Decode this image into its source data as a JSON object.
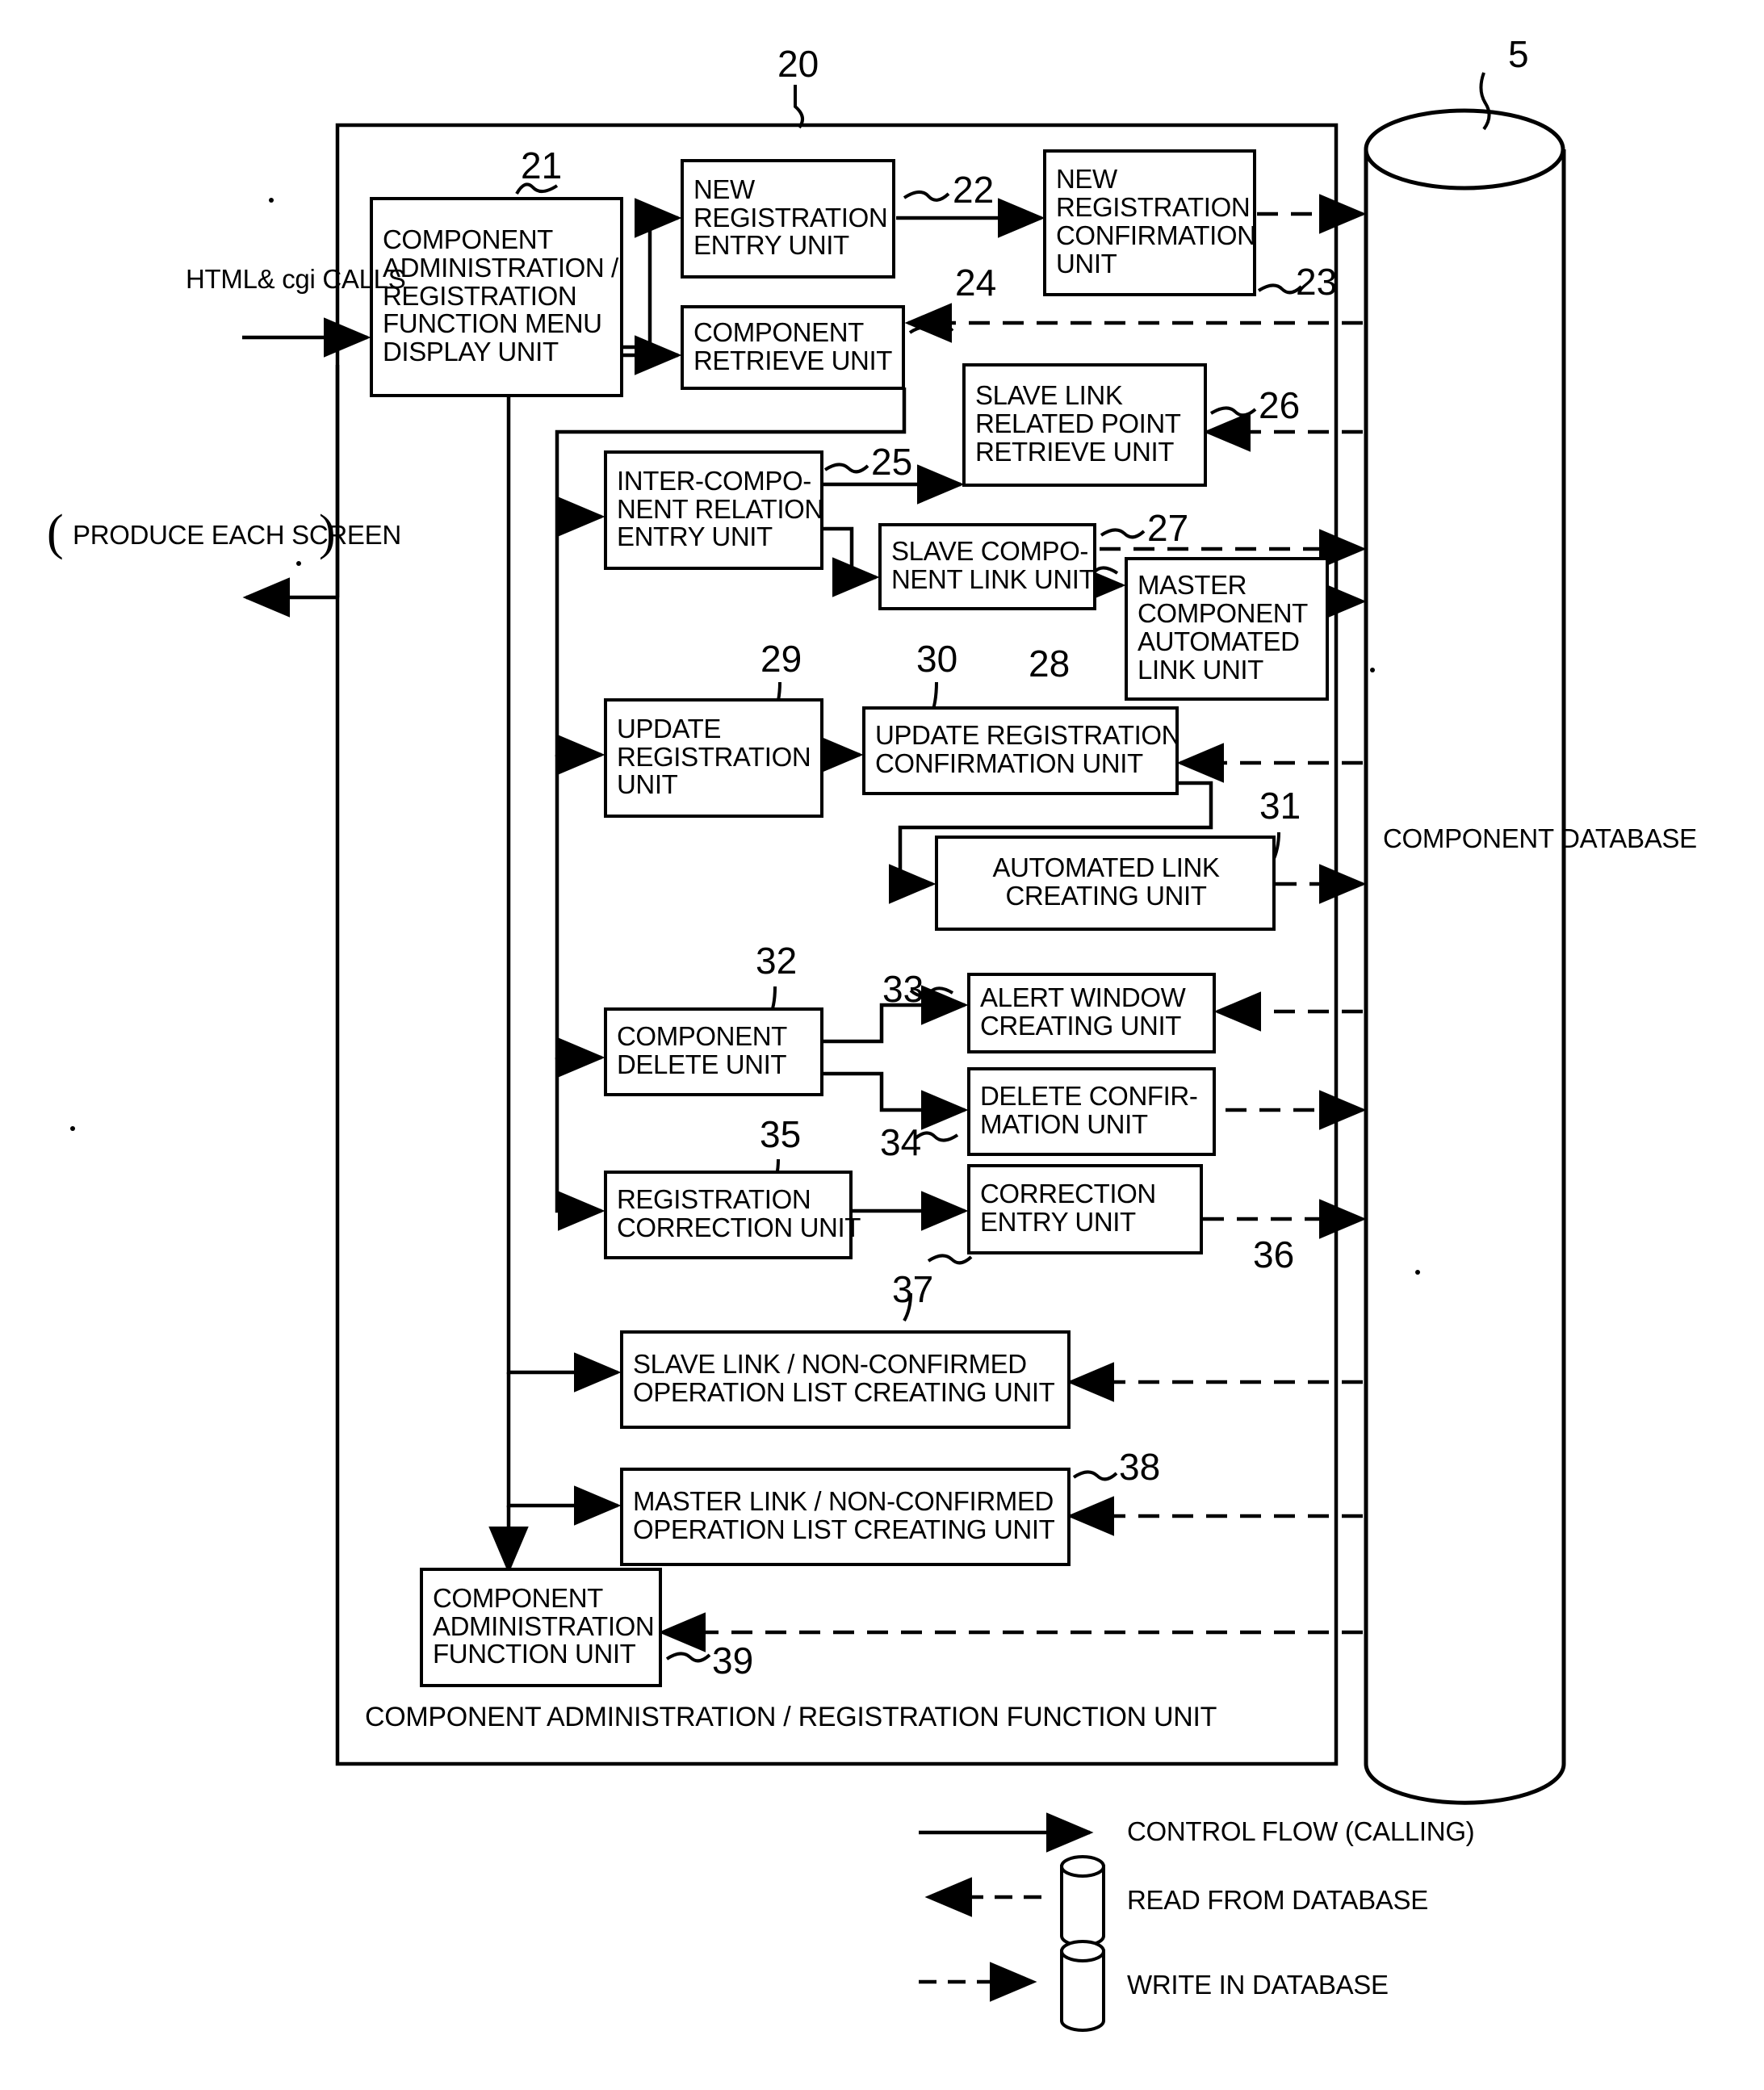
{
  "figure": {
    "outer_unit_label": "COMPONENT ADMINISTRATION / REGISTRATION FUNCTION UNIT",
    "outer_unit_ref": "20",
    "database_ref": "5",
    "database_label_line1": "COMPONENT",
    "database_label_line2": "DATABASE",
    "input_label_line1": "HTML&",
    "input_label_line2": "cgi CALLS",
    "output_label_line1": "PRODUCE EACH",
    "output_label_line2": "SCREEN",
    "paren_open": "(",
    "paren_close": ")"
  },
  "blocks": [
    {
      "id": "21",
      "ref": "21",
      "lines": [
        "COMPONENT",
        "ADMINISTRATION /",
        "REGISTRATION",
        "FUNCTION MENU",
        "DISPLAY UNIT"
      ]
    },
    {
      "id": "22",
      "ref": "22",
      "lines": [
        "NEW",
        "REGISTRATION",
        "ENTRY UNIT"
      ]
    },
    {
      "id": "23",
      "ref": "23",
      "lines": [
        "NEW",
        "REGISTRATION",
        "CONFIRMATION",
        "UNIT"
      ]
    },
    {
      "id": "24",
      "ref": "24",
      "lines": [
        "COMPONENT",
        "RETRIEVE UNIT"
      ]
    },
    {
      "id": "25",
      "ref": "25",
      "lines": [
        "INTER-COMPO-",
        "NENT RELATION",
        "ENTRY UNIT"
      ]
    },
    {
      "id": "26",
      "ref": "26",
      "lines": [
        "SLAVE LINK",
        "RELATED POINT",
        "RETRIEVE UNIT"
      ]
    },
    {
      "id": "27",
      "ref": "27",
      "lines": [
        "SLAVE COMPO-",
        "NENT LINK UNIT"
      ]
    },
    {
      "id": "28",
      "ref": "28",
      "lines": [
        "MASTER",
        "COMPONENT",
        "AUTOMATED",
        "LINK UNIT"
      ]
    },
    {
      "id": "29",
      "ref": "29",
      "lines": [
        "UPDATE",
        "REGISTRATION",
        "UNIT"
      ]
    },
    {
      "id": "30",
      "ref": "30",
      "lines": [
        "UPDATE REGISTRATION",
        "CONFIRMATION UNIT"
      ]
    },
    {
      "id": "31",
      "ref": "31",
      "lines": [
        "AUTOMATED LINK",
        "CREATING UNIT"
      ]
    },
    {
      "id": "32",
      "ref": "32",
      "lines": [
        "COMPONENT",
        "DELETE UNIT"
      ]
    },
    {
      "id": "33",
      "ref": "33",
      "lines": [
        "ALERT WINDOW",
        "CREATING UNIT"
      ]
    },
    {
      "id": "34",
      "ref": "34",
      "lines": [
        "DELETE CONFIR-",
        "MATION UNIT"
      ]
    },
    {
      "id": "35",
      "ref": "35",
      "lines": [
        "REGISTRATION",
        "CORRECTION UNIT"
      ]
    },
    {
      "id": "36",
      "ref": "36",
      "lines": [
        "CORRECTION",
        "ENTRY UNIT"
      ]
    },
    {
      "id": "37",
      "ref": "37",
      "lines": [
        "SLAVE LINK / NON-CONFIRMED",
        "OPERATION  LIST CREATING UNIT"
      ]
    },
    {
      "id": "38",
      "ref": "38",
      "lines": [
        "MASTER LINK / NON-CONFIRMED",
        "OPERATION  LIST CREATING UNIT"
      ]
    },
    {
      "id": "39",
      "ref": "39",
      "lines": [
        "COMPONENT",
        "ADMINISTRATION",
        "FUNCTION UNIT"
      ]
    }
  ],
  "legend": [
    {
      "key": "control-flow",
      "label": "CONTROL FLOW  (CALLING)",
      "style": "solid-arrow-right"
    },
    {
      "key": "read-from-database",
      "label": "READ FROM DATABASE",
      "style": "dashed-arrow-left-cylinder"
    },
    {
      "key": "write-in-database",
      "label": "WRITE IN DATABASE",
      "style": "dashed-arrow-right-cylinder"
    }
  ],
  "colors": {
    "ink": "#000000",
    "paper": "#ffffff"
  }
}
